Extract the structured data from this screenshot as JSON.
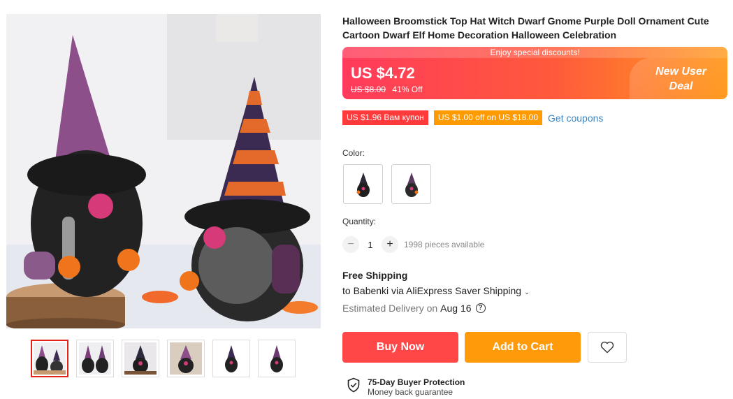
{
  "product": {
    "title": "Halloween Broomstick Top Hat Witch Dwarf Gnome Purple Doll Ornament Cute Cartoon Dwarf Elf Home Decoration Halloween Celebration"
  },
  "gallery": {
    "thumbnail_count": 6,
    "active_thumbnail": 1
  },
  "price": {
    "banner_strip": "Enjoy special discounts!",
    "current": "US $4.72",
    "original": "US $8.00",
    "discount": "41% Off",
    "deal_line1": "New User",
    "deal_line2": "Deal"
  },
  "coupons": [
    {
      "label": "US $1.96 Вам купон"
    },
    {
      "label": "US $1.00 off on US $18.00"
    }
  ],
  "get_coupons": "Get coupons",
  "color": {
    "label": "Color:",
    "options_count": 2
  },
  "quantity": {
    "label": "Quantity:",
    "value": "1",
    "minus": "−",
    "plus": "+",
    "available": "1998 pieces available"
  },
  "shipping": {
    "title": "Free Shipping",
    "line": "to Babenki via AliExpress Saver Shipping",
    "chevron": "⌄",
    "delivery_prefix": "Estimated Delivery on",
    "delivery_date": "Aug 16",
    "help": "?"
  },
  "actions": {
    "buy_now": "Buy Now",
    "add_to_cart": "Add to Cart"
  },
  "protection": {
    "title": "75-Day Buyer Protection",
    "subtitle": "Money back guarantee"
  },
  "colors": {
    "accent_red": "#ff4747",
    "accent_orange": "#ff9a0a",
    "link_blue": "#3b84bf"
  }
}
